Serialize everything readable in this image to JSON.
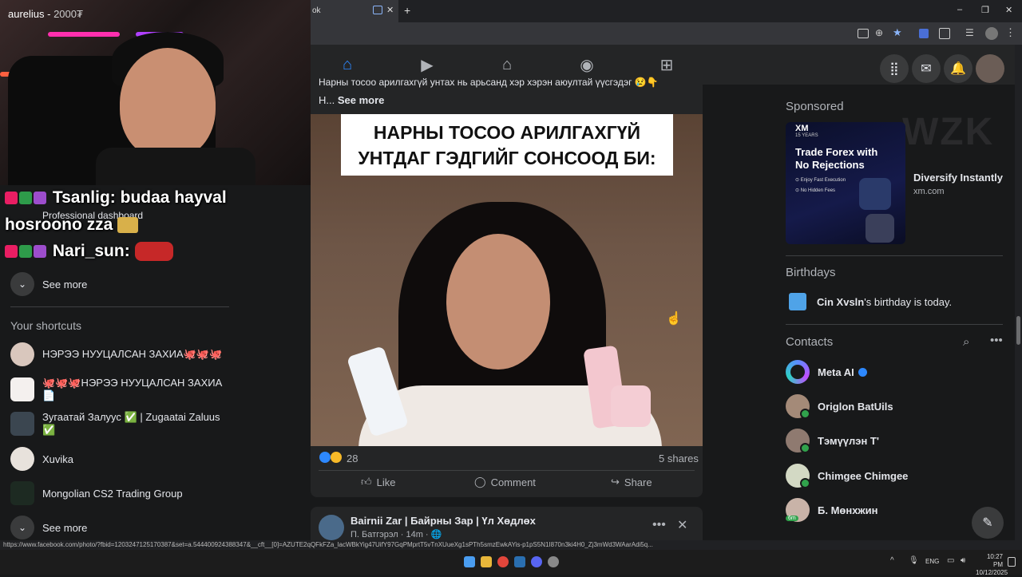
{
  "stream": {
    "streamer_name": "aurelius - ",
    "viewer_count": "2000₮"
  },
  "chat": [
    {
      "user": "Tsanlig:",
      "message": "budaa hayval"
    },
    {
      "user": "",
      "message": "hosroono zza"
    },
    {
      "user": "Nari_sun:",
      "message": ""
    }
  ],
  "left_menu": {
    "professional_dashboard": "Professional dashboard",
    "see_more_top": "See more",
    "shortcuts_title": "Your shortcuts",
    "shortcuts": [
      {
        "label": "НЭРЭЭ НУУЦАЛСАН ЗАХИА🐙🐙🐙"
      },
      {
        "label": "🐙🐙🐙НЭРЭЭ НУУЦАЛСАН ЗАХИА📄"
      },
      {
        "label": "Зугаатай Залуус ✅ | Zugaatai Zaluus ✅"
      },
      {
        "label": "Xuvika"
      },
      {
        "label": "Mongolian CS2 Trading Group"
      }
    ],
    "see_more_bottom": "See more"
  },
  "browser": {
    "tab_title": "ok",
    "new_tab": "+",
    "win_min": "–",
    "win_max": "❐",
    "win_close": "✕"
  },
  "post": {
    "text_line": "Нарны тосоо арилгахгүй унтах нь арьсанд хэр хэрэн аюултай үүсгэдэг 😢👇",
    "text_prefix": "H...",
    "see_more": "See more",
    "image_caption_line1": "НАРНЫ ТОСОО АРИЛГАХГҮЙ",
    "image_caption_line2": "УНТДАГ ГЭДГИЙГ СОНСООД БИ:",
    "reaction_count": "28",
    "shares": "5 shares",
    "like_label": "Like",
    "comment_label": "Comment",
    "share_label": "Share"
  },
  "post2": {
    "page_name": "Bairnii Zar | Байрны Зар | Үл Хөдлөх",
    "author": "П. Батгэрэл",
    "time": "· 14m · 🌐"
  },
  "right": {
    "sponsored_title": "Sponsored",
    "ad_brand": "XM",
    "ad_years": "15 YEARS",
    "ad_headline": "Trade Forex with No Rejections",
    "ad_bullet1": "⊙ Enjoy Fast Execution",
    "ad_bullet2": "⊙ No Hidden Fees",
    "ad_title": "Diversify Instantly",
    "ad_domain": "xm.com",
    "birthdays_title": "Birthdays",
    "birthday_name": "Cin Xvsln",
    "birthday_text": "'s birthday is today.",
    "contacts_title": "Contacts",
    "contacts": [
      {
        "name": "Meta AI"
      },
      {
        "name": "Origlon BatUils"
      },
      {
        "name": "Тэмүүлэн Т'"
      },
      {
        "name": "Chimgee Chimgee"
      },
      {
        "name": "Б. Мөнхжин"
      }
    ],
    "contact_badge_6m": "6m",
    "watermark": "WZK"
  },
  "status_url": "https://www.facebook.com/photo/?fbid=1203247125170387&set=a.544400924388347&__cft__[0]=AZUTE2qQFkFZa_lacWBkYig47UifY97GqPMprtT5vTnXUueXg1sPTh5smzEwkAYis-p1pS5N1I870n3ki4H0_Zj3mWd3WAarAdi5q...",
  "taskbar": {
    "lang": "ENG",
    "time": "10:27 PM",
    "date": "10/12/2025"
  },
  "colors": {
    "fb_blue": "#2d88ff",
    "online_green": "#31a24c"
  }
}
